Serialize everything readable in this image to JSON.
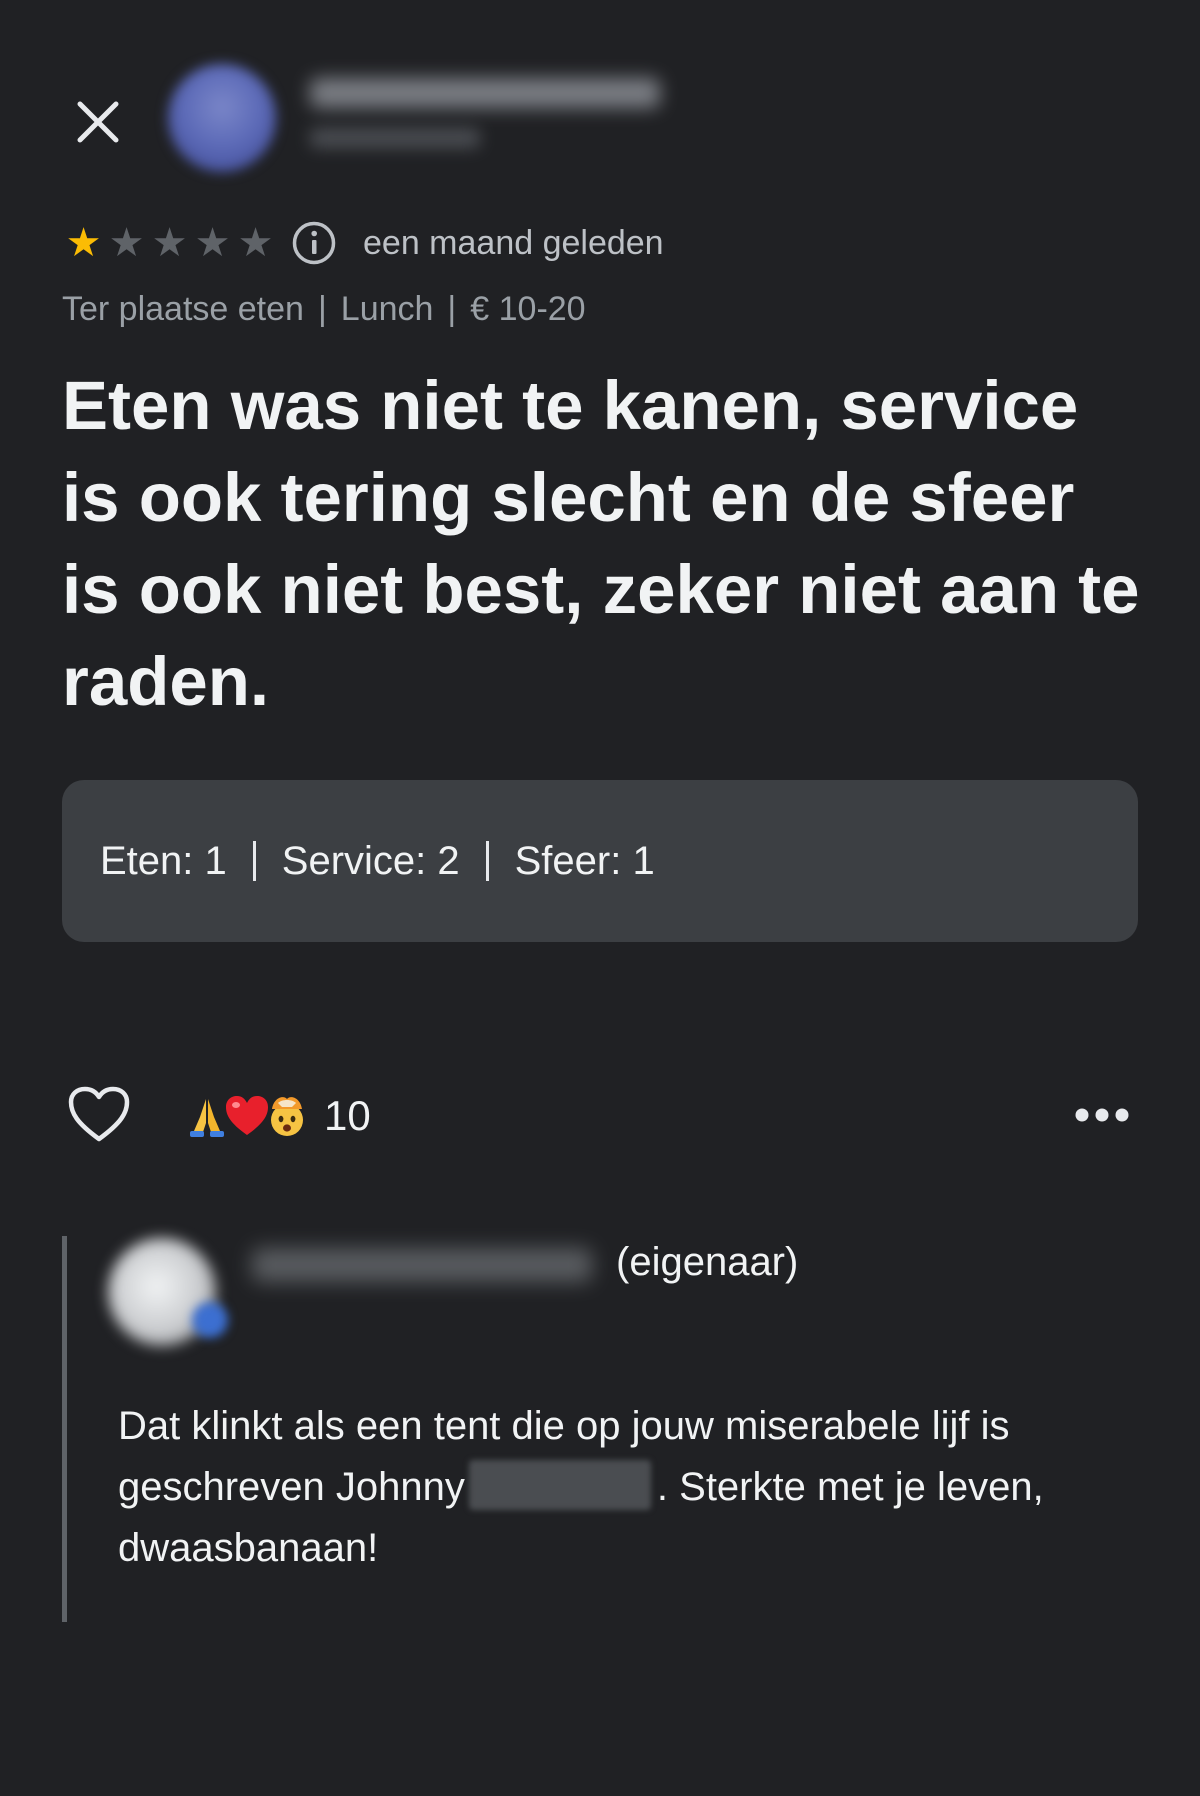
{
  "header": {
    "close_icon": "close-icon",
    "reviewer_avatar": "blurred-avatar"
  },
  "rating": {
    "stars": 1,
    "max_stars": 5,
    "star_filled_color": "#fbbc04",
    "star_empty_color": "#5f6368",
    "info_icon": "info-icon",
    "time_ago": "een maand geleden"
  },
  "details": {
    "items": [
      "Ter plaatse eten",
      "Lunch",
      "€ 10-20"
    ],
    "separator": "|"
  },
  "review": {
    "text": "Eten was niet te kanen, service is ook tering slecht en de sfeer is ook niet best, zeker niet aan te raden."
  },
  "subratings": {
    "items": [
      "Eten: 1",
      "Service: 2",
      "Sfeer: 1"
    ]
  },
  "actions": {
    "like_icon": "heart-outline-icon",
    "reaction_icons": [
      "folded-hands-emoji",
      "red-heart-emoji",
      "exploding-head-emoji"
    ],
    "reaction_count": "10",
    "more_icon": "more-horizontal-icon"
  },
  "owner_reply": {
    "owner_label": "(eigenaar)",
    "text_part1": "Dat klinkt als een tent die op jouw miserabele lijf is geschreven Johnny",
    "text_part2": ". Sterkte met je leven, dwaasbanaan!"
  }
}
